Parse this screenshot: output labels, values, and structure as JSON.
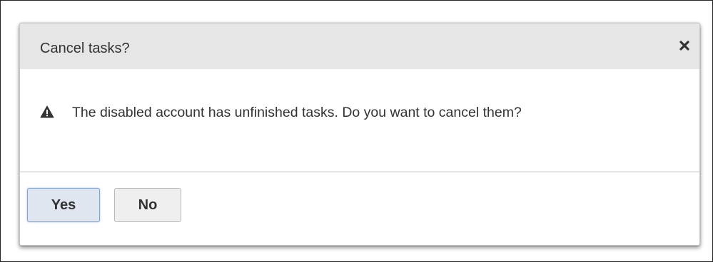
{
  "dialog": {
    "title": "Cancel tasks?",
    "close_icon": "close-icon",
    "warning_icon": "warning-icon",
    "message": "The disabled account has unfinished tasks. Do you want to cancel them?",
    "buttons": {
      "yes_label": "Yes",
      "no_label": "No"
    }
  },
  "colors": {
    "header_bg": "#e6e6e6",
    "text": "#333333",
    "focused_button_border": "#7fa6d6"
  }
}
